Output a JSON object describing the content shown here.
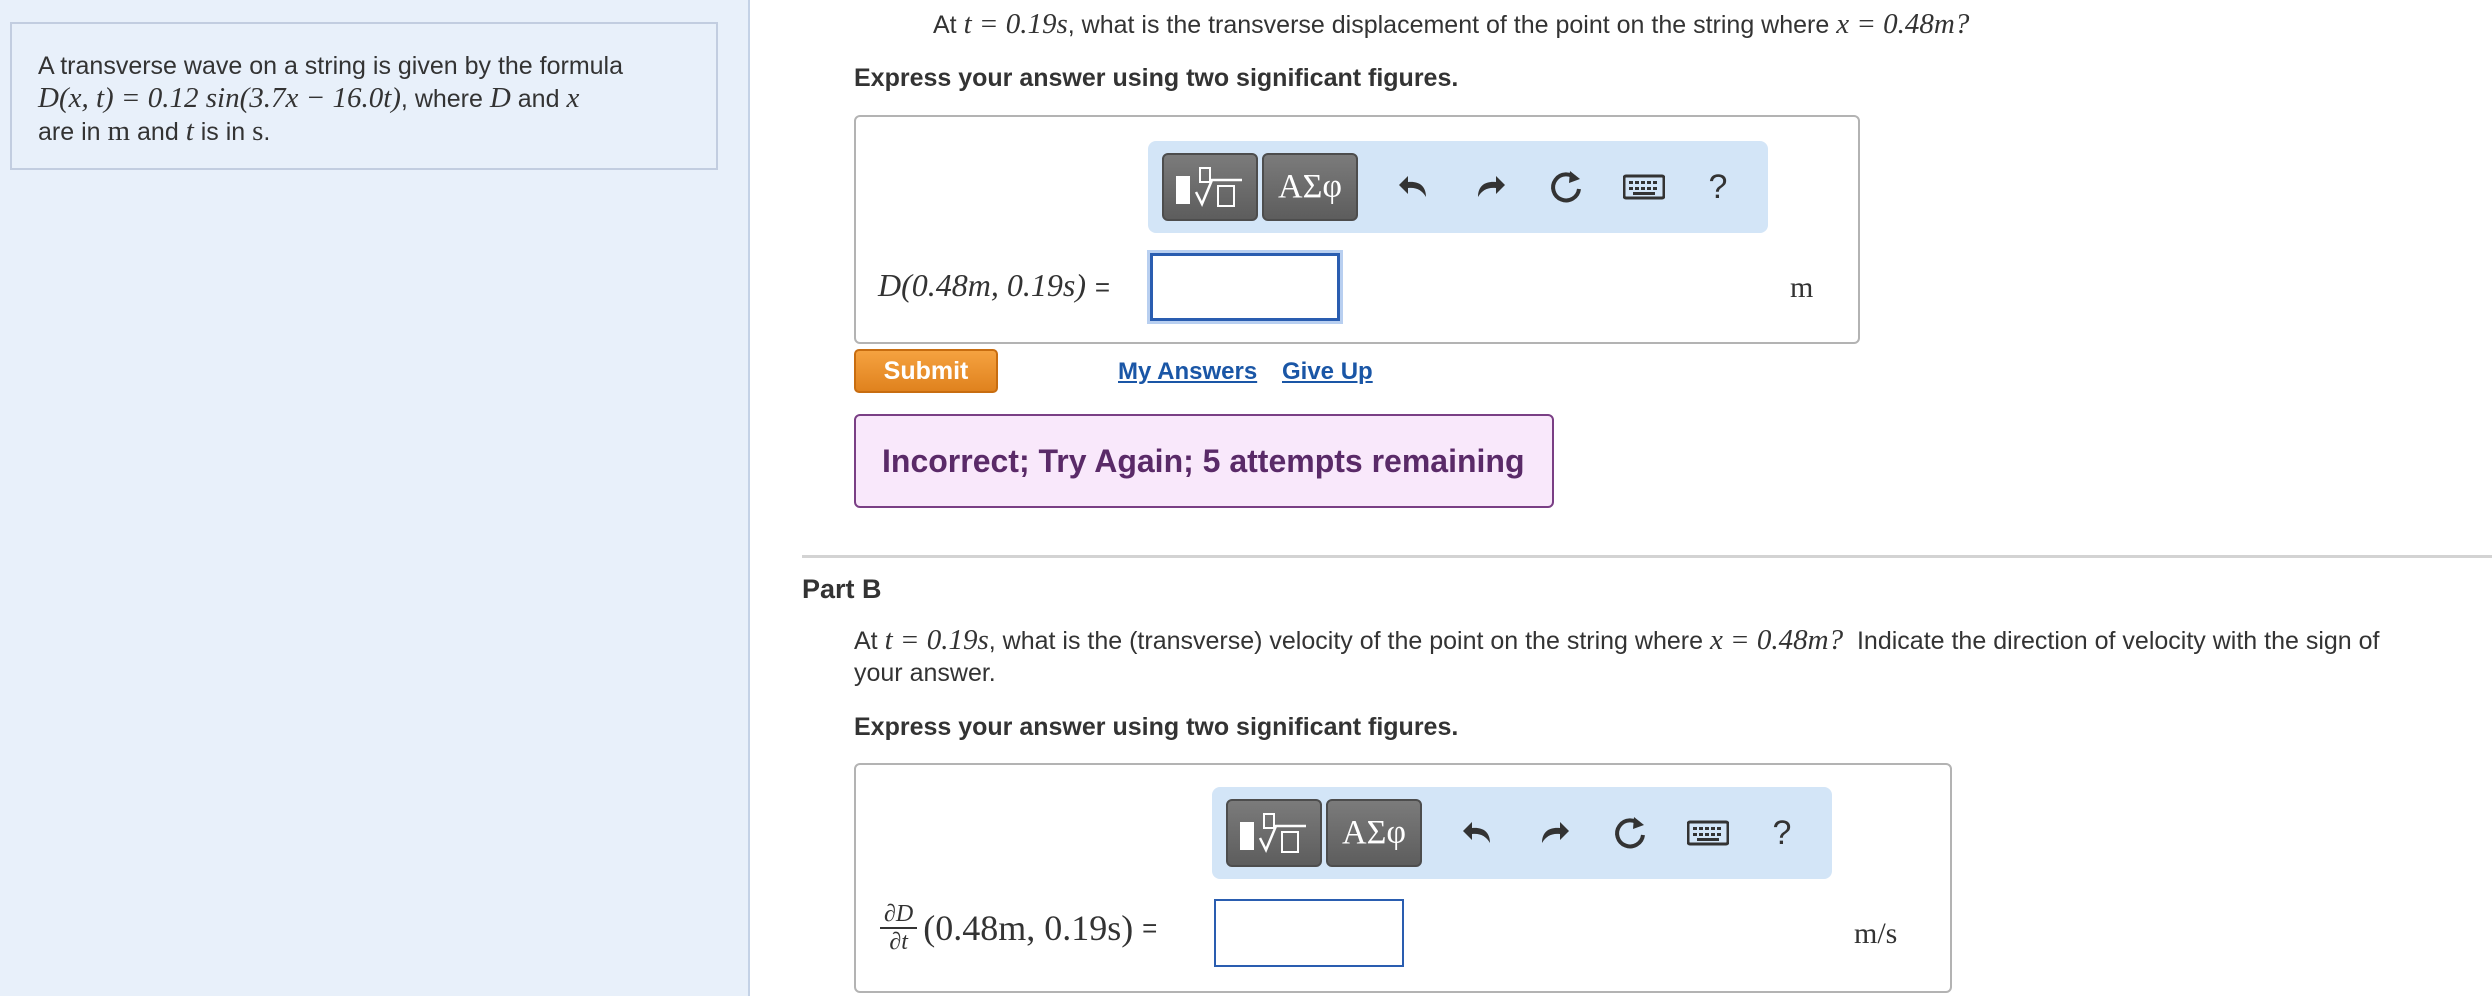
{
  "problem": {
    "intro_line1": "A transverse wave on a string is given by the formula",
    "intro_formula": "D(x, t) = 0.12 sin(3.7x − 16.0t)",
    "intro_where": ", where",
    "intro_var_D": "D",
    "intro_and": "and",
    "intro_var_x": "x",
    "intro_line3_a": "are in",
    "intro_unit_m": "m",
    "intro_line3_and": "and",
    "intro_var_t": "t",
    "intro_line3_b": "is in",
    "intro_unit_s": "s",
    "intro_period": "."
  },
  "part_a": {
    "q_prefix": "At",
    "q_t_expr": "t = 0.19s",
    "q_mid": ", what is the transverse displacement of the point on the string where",
    "q_x_expr": "x = 0.48m?",
    "instruction": "Express your answer using two significant figures.",
    "answer_label": "D(0.48m, 0.19s)",
    "equals": "=",
    "input_value": "",
    "unit": "m",
    "toolbar": {
      "templates_icon": "sqrt-template-icon",
      "symbols_label": "ΑΣφ",
      "undo_icon": "undo-icon",
      "redo_icon": "redo-icon",
      "reset_icon": "reset-icon",
      "keyboard_icon": "keyboard-icon",
      "help_label": "?"
    },
    "submit_label": "Submit",
    "my_answers_label": "My Answers",
    "give_up_label": "Give Up",
    "feedback": "Incorrect; Try Again; 5 attempts remaining"
  },
  "part_b": {
    "title": "Part B",
    "q_prefix": "At",
    "q_t_expr": "t = 0.19s",
    "q_mid": ", what is the (transverse) velocity of the point on the string where",
    "q_x_expr": "x = 0.48m?",
    "q_suffix": "Indicate the direction of velocity with the sign of",
    "q_line2": "your answer.",
    "instruction": "Express your answer using two significant figures.",
    "frac_num": "∂D",
    "frac_den": "∂t",
    "answer_label": "(0.48m, 0.19s)",
    "equals": "=",
    "input_value": "",
    "unit": "m/s",
    "toolbar": {
      "symbols_label": "ΑΣφ",
      "help_label": "?"
    }
  },
  "colors": {
    "left_panel_bg": "#e8f0fa",
    "toolbar_bg": "#d3e5f7",
    "submit_orange": "#e8891f",
    "link_blue": "#1a56a6",
    "feedback_bg": "#f9e8fb",
    "feedback_text": "#5a2a68"
  }
}
